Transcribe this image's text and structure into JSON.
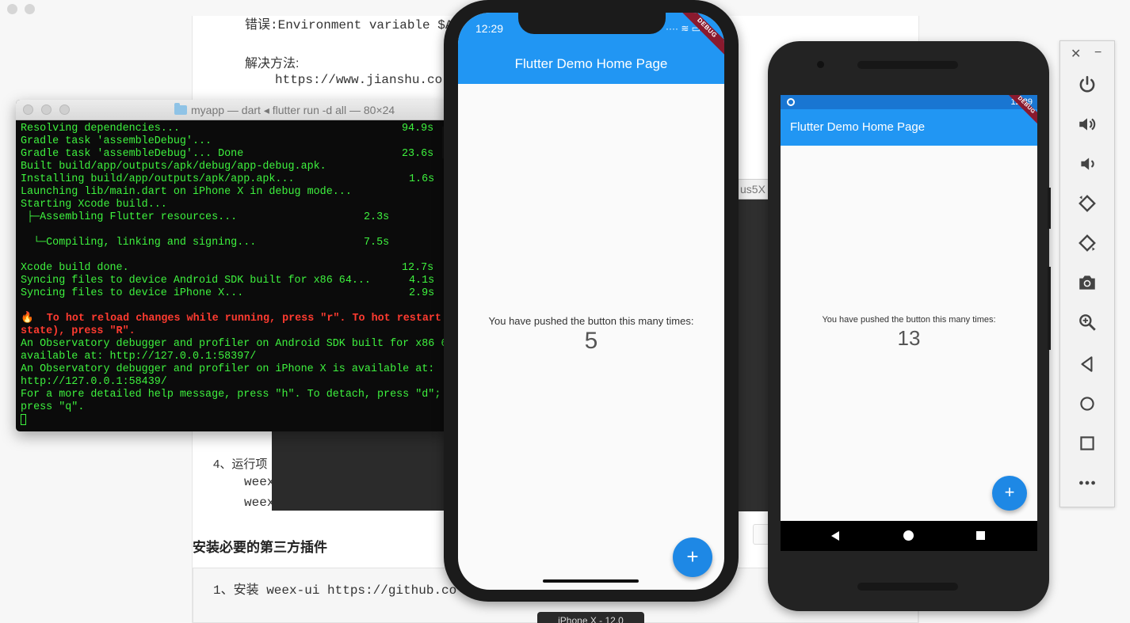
{
  "document": {
    "line_error": "错误:Environment variable $A",
    "line_solution": "解决方法:",
    "line_url": "https://www.jianshu.co",
    "line_step4": "4、运行项",
    "line_weex1": "weex",
    "line_weex2": "weex",
    "heading_plugins": "安装必要的第三方插件",
    "line_install": "1、安装 weex-ui https://github.co",
    "tab_fragment": "us5X"
  },
  "terminal": {
    "title": "myapp — dart ◂ flutter run -d all — 80×24",
    "lines": [
      {
        "text": "Resolving dependencies...",
        "time": "94.9s"
      },
      {
        "text": "Gradle task 'assembleDebug'...",
        "time": ""
      },
      {
        "text": "Gradle task 'assembleDebug'... Done",
        "time": "23.6s"
      },
      {
        "text": "Built build/app/outputs/apk/debug/app-debug.apk.",
        "time": ""
      },
      {
        "text": "Installing build/app/outputs/apk/app.apk...",
        "time": "1.6s"
      },
      {
        "text": "Launching lib/main.dart on iPhone X in debug mode...",
        "time": ""
      },
      {
        "text": "Starting Xcode build...",
        "time": ""
      },
      {
        "text": " ├─Assembling Flutter resources...",
        "time": "2.3s"
      },
      {
        "text": "",
        "time": ""
      },
      {
        "text": "  └─Compiling, linking and signing...",
        "time": "7.5s"
      },
      {
        "text": "",
        "time": ""
      },
      {
        "text": "Xcode build done.",
        "time": "12.7s"
      },
      {
        "text": "Syncing files to device Android SDK built for x86 64...",
        "time": "4.1s"
      },
      {
        "text": "Syncing files to device iPhone X...",
        "time": "2.9s"
      },
      {
        "text": "",
        "time": ""
      }
    ],
    "hot_reload_line1": "🔥  To hot reload changes while running, press \"r\". To hot restart",
    "hot_reload_line2": "state), press \"R\".",
    "tail": [
      "An Observatory debugger and profiler on Android SDK built for x86 6",
      "available at: http://127.0.0.1:58397/",
      "An Observatory debugger and profiler on iPhone X is available at:",
      "http://127.0.0.1:58439/",
      "For a more detailed help message, press \"h\". To detach, press \"d\";",
      "press \"q\"."
    ]
  },
  "ios": {
    "time": "12:29",
    "status": "····  ≋  ▭",
    "title": "Flutter Demo Home Page",
    "debug_banner": "DEBUG",
    "label": "You have pushed the button this many times:",
    "count": "5",
    "fab_label": "+",
    "device_label": "iPhone X - 12.0",
    "accent": "#2196f3"
  },
  "android": {
    "time": "12:29",
    "title": "Flutter Demo Home Page",
    "debug_banner": "DEBUG",
    "label": "You have pushed the button this many times:",
    "count": "13",
    "fab_label": "+",
    "accent": "#2196f3",
    "status_bar_color": "#1976d2"
  },
  "emulator_toolbar": {
    "close": "✕",
    "minimize": "−",
    "buttons": [
      "power-icon",
      "volume-up-icon",
      "volume-down-icon",
      "rotate-left-icon",
      "rotate-right-icon",
      "camera-icon",
      "zoom-icon",
      "back-icon",
      "home-icon",
      "overview-icon",
      "more-icon"
    ]
  }
}
